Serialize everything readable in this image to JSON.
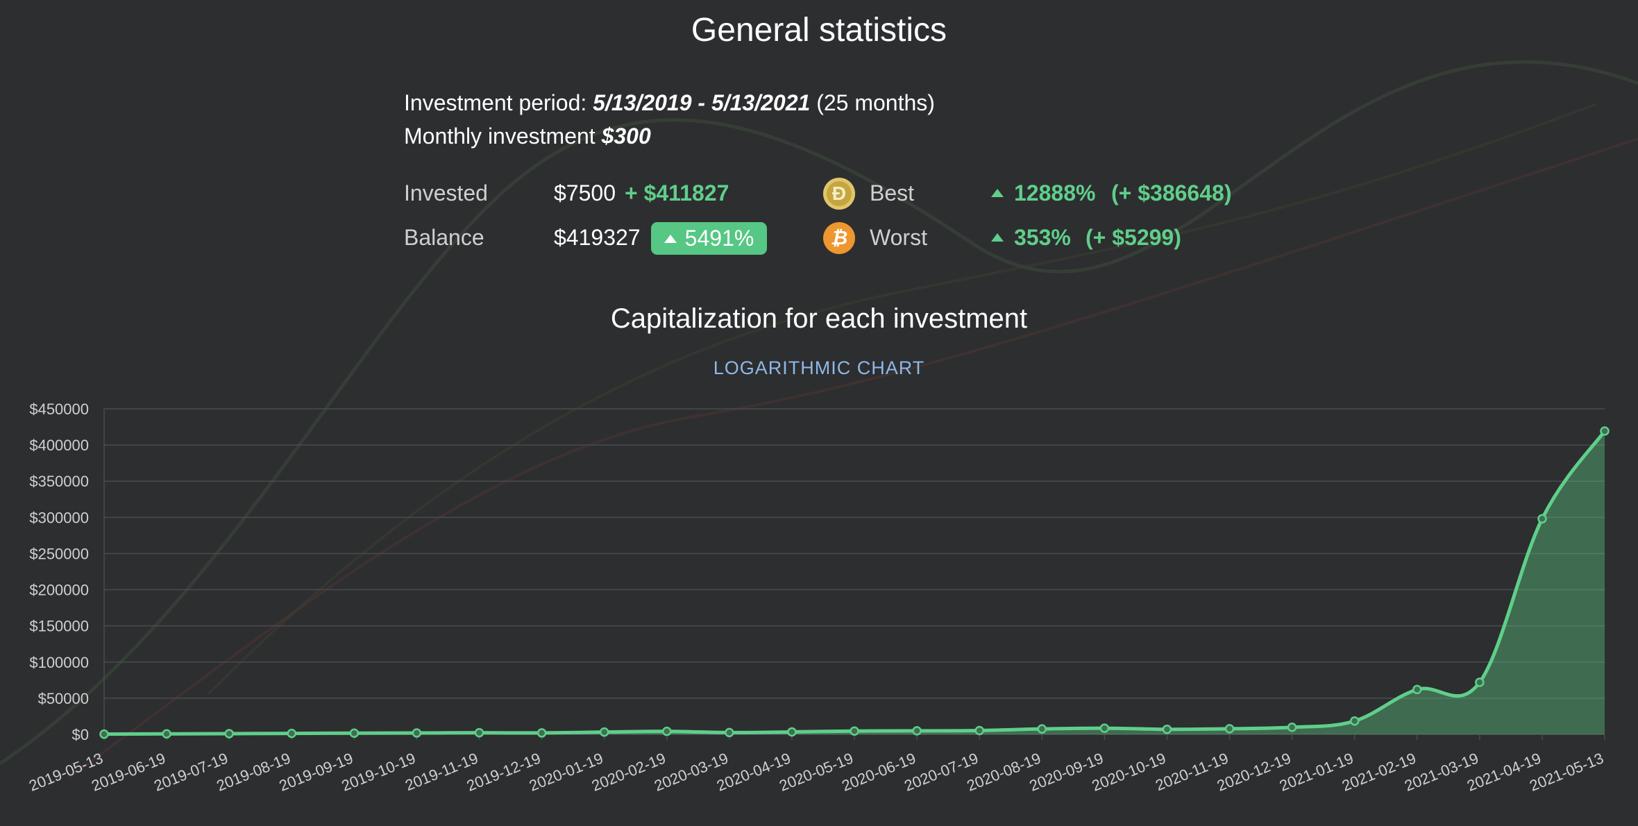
{
  "header": {
    "title": "General statistics"
  },
  "summary": {
    "period_label": "Investment period:",
    "period_value": "5/13/2019 - 5/13/2021",
    "period_months": "(25 months)",
    "monthly_label": "Monthly investment",
    "monthly_value": "$300",
    "invested_label": "Invested",
    "invested_value": "$7500",
    "invested_gain": "+ $411827",
    "balance_label": "Balance",
    "balance_value": "$419327",
    "balance_percent": "5491%",
    "best_label": "Best",
    "best_percent": "12888%",
    "best_gain": "(+ $386648)",
    "best_coin_icon": "dogecoin-icon",
    "worst_label": "Worst",
    "worst_percent": "353%",
    "worst_gain": "(+ $5299)",
    "worst_coin_icon": "bitcoin-icon",
    "accent_green": "#56c784"
  },
  "chart_section": {
    "title": "Capitalization for each investment",
    "log_toggle": "LOGARITHMIC CHART"
  },
  "chart_data": {
    "type": "area",
    "categories": [
      "2019-05-13",
      "2019-06-19",
      "2019-07-19",
      "2019-08-19",
      "2019-09-19",
      "2019-10-19",
      "2019-11-19",
      "2019-12-19",
      "2020-01-19",
      "2020-02-19",
      "2020-03-19",
      "2020-04-19",
      "2020-05-19",
      "2020-06-19",
      "2020-07-19",
      "2020-08-19",
      "2020-09-19",
      "2020-10-19",
      "2020-11-19",
      "2020-12-19",
      "2021-01-19",
      "2021-02-19",
      "2021-03-19",
      "2021-04-19",
      "2021-05-13"
    ],
    "series": [
      {
        "values": [
          300,
          700,
          1000,
          1300,
          1700,
          1900,
          2300,
          2000,
          3200,
          4200,
          2500,
          3400,
          4600,
          4900,
          5300,
          7500,
          8500,
          7000,
          7800,
          9800,
          18500,
          62000,
          72000,
          298000,
          419327
        ],
        "color": "#5fcf8a"
      }
    ],
    "ylim": [
      0,
      450000
    ],
    "yticks": [
      "$0",
      "$50000",
      "$100000",
      "$150000",
      "$200000",
      "$250000",
      "$300000",
      "$350000",
      "$400000",
      "$450000"
    ],
    "ytick_values": [
      0,
      50000,
      100000,
      150000,
      200000,
      250000,
      300000,
      350000,
      400000,
      450000
    ],
    "grid": true,
    "xlabel": "",
    "ylabel": ""
  }
}
